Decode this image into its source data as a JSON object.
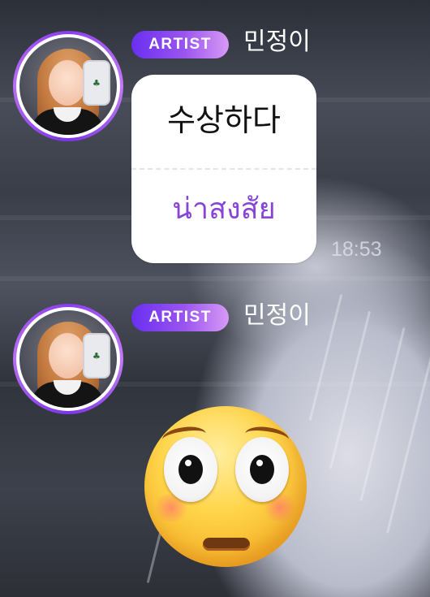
{
  "messages": [
    {
      "badge": "ARTIST",
      "author": "민정이",
      "bubble": {
        "line1": "수상하다",
        "line2": "น่าสงสัย"
      },
      "time": "18:53"
    },
    {
      "badge": "ARTIST",
      "author": "민정이",
      "emoji": "flushed-face-emoji"
    }
  ],
  "colors": {
    "badge_gradient_start": "#6a2ff0",
    "badge_gradient_end": "#d79af6",
    "translation_text": "#8744d6",
    "avatar_ring": "#8b3df0"
  }
}
